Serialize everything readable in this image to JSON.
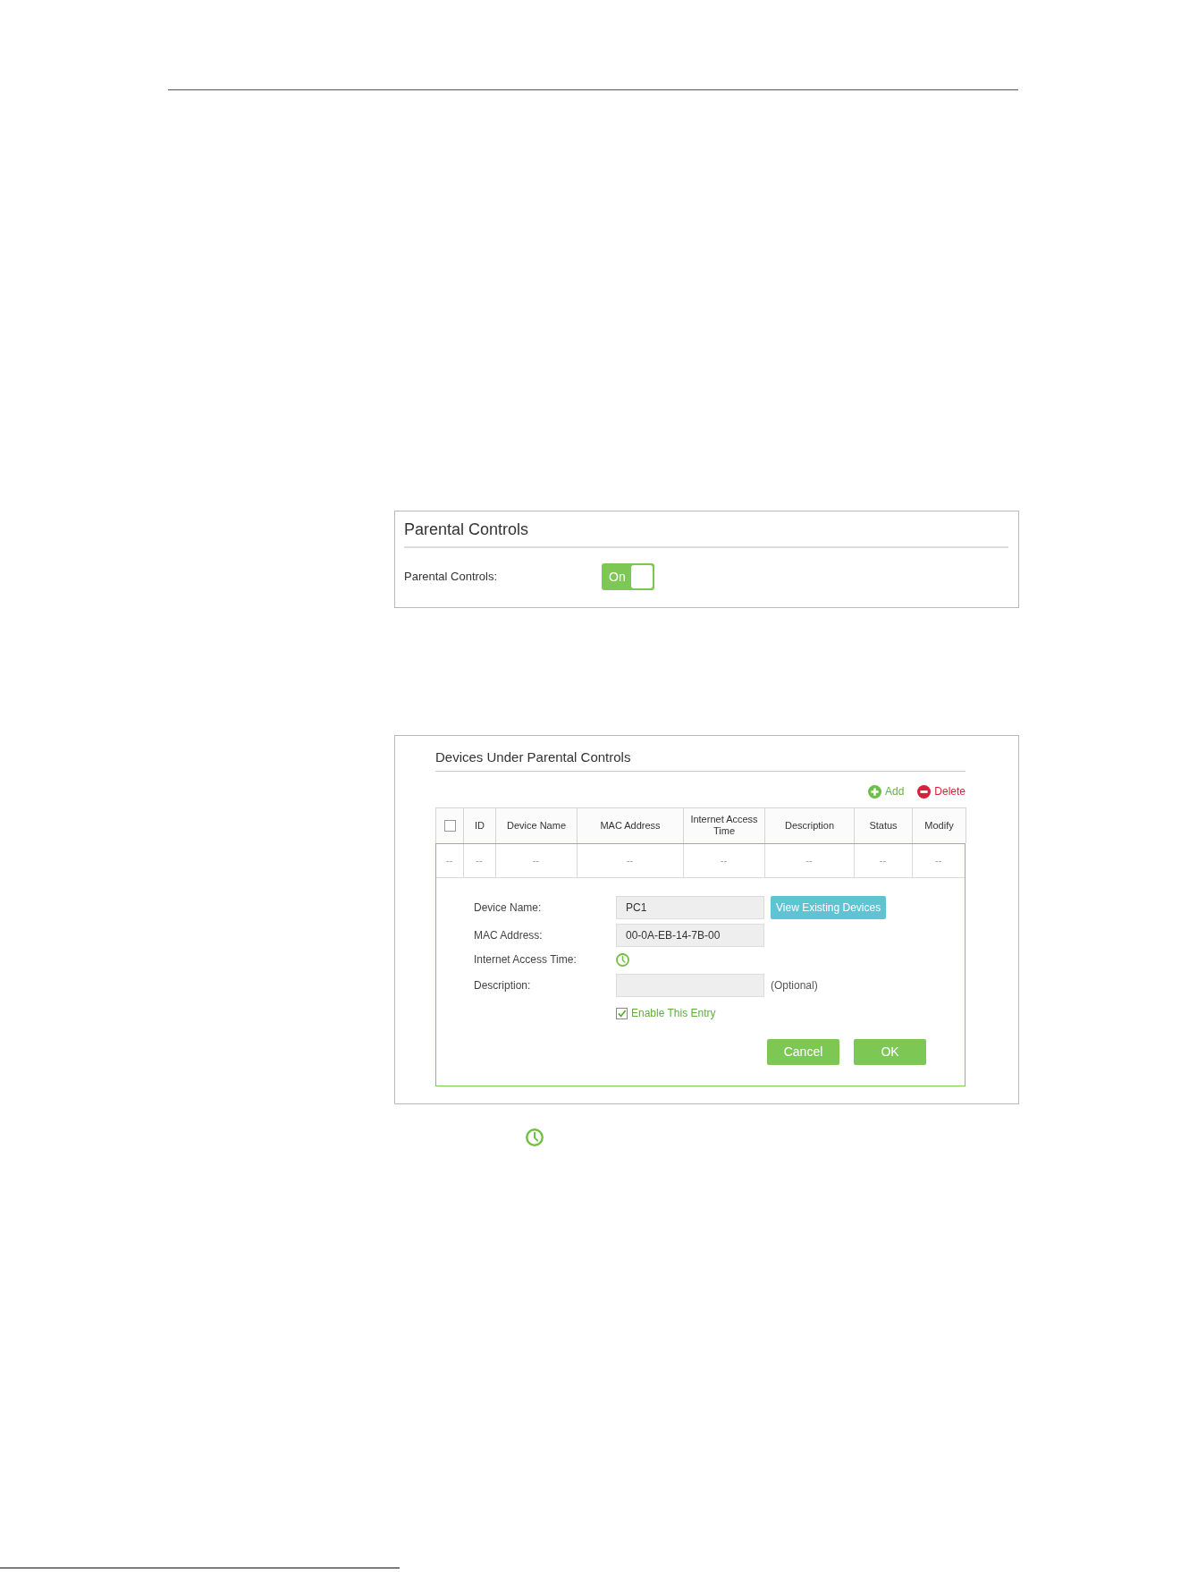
{
  "parental_controls": {
    "title": "Parental Controls",
    "label": "Parental Controls:",
    "toggle": {
      "label": "On",
      "on": true
    }
  },
  "devices": {
    "title": "Devices Under Parental Controls",
    "actions": [
      {
        "kind": "add",
        "label": "Add"
      },
      {
        "kind": "delete",
        "label": "Delete"
      }
    ],
    "table": {
      "columns": [
        {
          "kind": "checkbox",
          "checked": false
        },
        {
          "kind": "text",
          "label": "ID"
        },
        {
          "kind": "text",
          "label": "Device Name"
        },
        {
          "kind": "text",
          "label": "MAC Address"
        },
        {
          "kind": "text",
          "label": "Internet Access Time"
        },
        {
          "kind": "text",
          "label": "Description"
        },
        {
          "kind": "text",
          "label": "Status"
        },
        {
          "kind": "text",
          "label": "Modify"
        }
      ],
      "rows": [
        [
          "--",
          "--",
          "--",
          "--",
          "--",
          "--",
          "--",
          "--"
        ]
      ]
    },
    "form": {
      "fields": [
        {
          "kind": "text",
          "label": "Device Name:",
          "value": "PC1",
          "button": "View Existing Devices"
        },
        {
          "kind": "text",
          "label": "MAC Address:",
          "value": "00-0A-EB-14-7B-00"
        },
        {
          "kind": "schedule",
          "label": "Internet Access Time:"
        },
        {
          "kind": "text",
          "label": "Description:",
          "note": "(Optional)"
        }
      ],
      "enable_entry": {
        "label": "Enable This Entry",
        "checked": true
      },
      "buttons": [
        "Cancel",
        "OK"
      ]
    }
  }
}
